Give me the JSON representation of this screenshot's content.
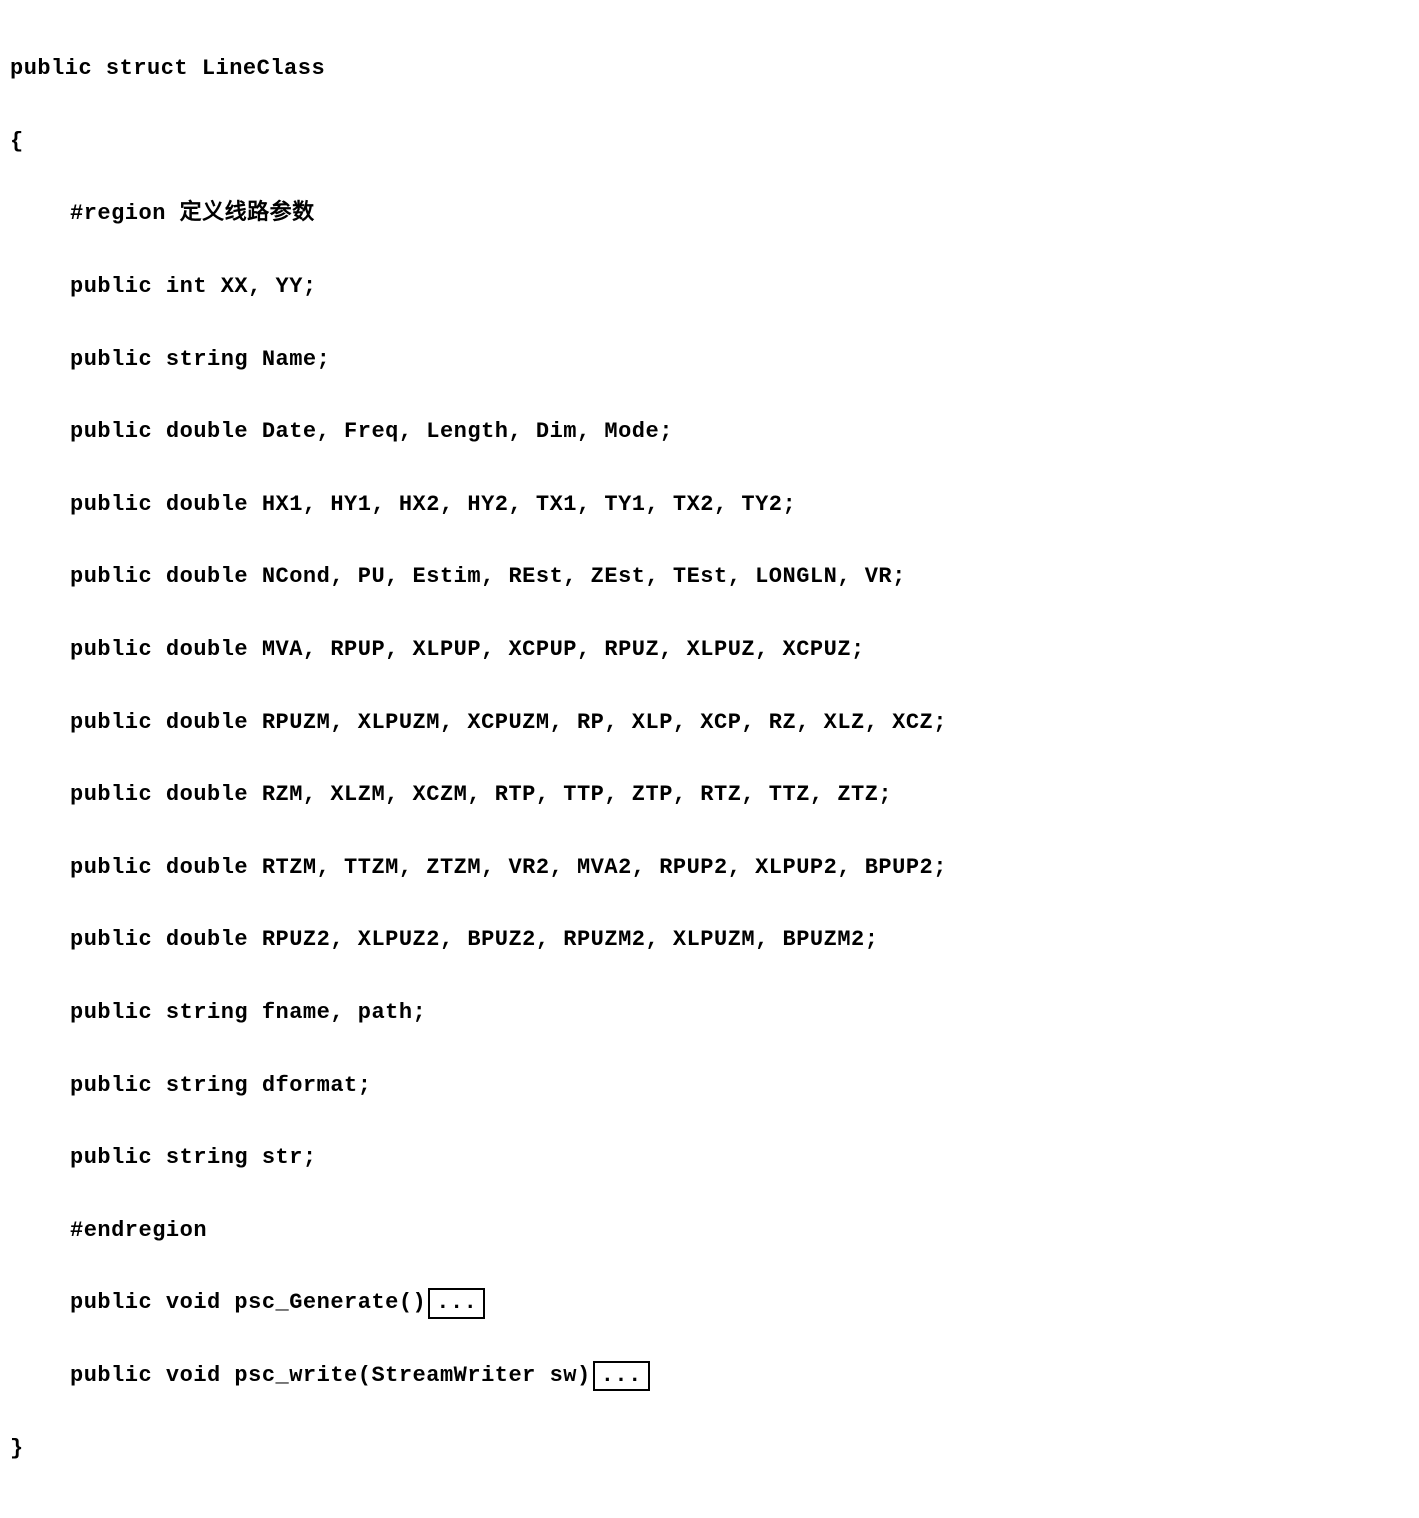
{
  "code": {
    "line1": "public struct LineClass",
    "line2": "{",
    "line3": "#region 定义线路参数",
    "line4": "public int XX, YY;",
    "line5": "public string Name;",
    "line6": "public double Date, Freq, Length, Dim, Mode;",
    "line7": "public double HX1, HY1, HX2, HY2, TX1, TY1, TX2, TY2;",
    "line8": "public double NCond, PU, Estim, REst, ZEst, TEst, LONGLN, VR;",
    "line9": "public double MVA, RPUP, XLPUP, XCPUP, RPUZ, XLPUZ, XCPUZ;",
    "line10": "public double RPUZM, XLPUZM, XCPUZM, RP, XLP, XCP, RZ, XLZ, XCZ;",
    "line11": "public double RZM, XLZM, XCZM, RTP, TTP, ZTP, RTZ, TTZ, ZTZ;",
    "line12": "public double RTZM, TTZM, ZTZM, VR2, MVA2, RPUP2, XLPUP2, BPUP2;",
    "line13": "public double RPUZ2, XLPUZ2, BPUZ2, RPUZM2, XLPUZM, BPUZM2;",
    "line14": "public string fname, path;",
    "line15": "public string dformat;",
    "line16": "public string str;",
    "line17": "#endregion",
    "line18a": "public void psc_Generate()",
    "line18b": "...",
    "line19a": "public void psc_write(StreamWriter sw)",
    "line19b": "...",
    "line20": "}"
  }
}
